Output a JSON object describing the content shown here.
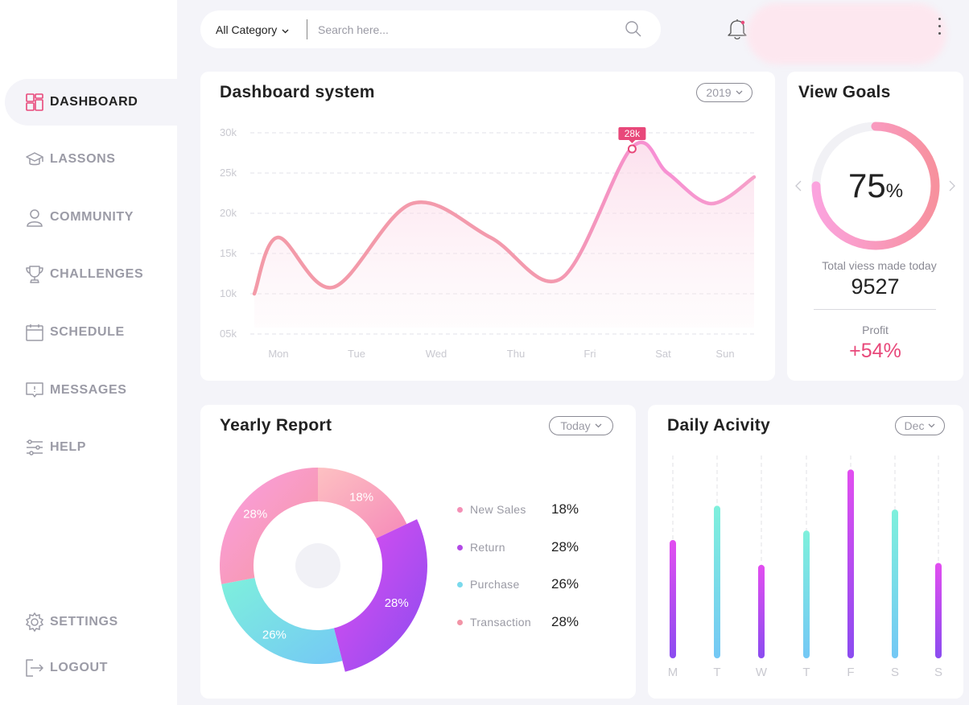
{
  "sidebar": {
    "items": [
      {
        "label": "DASHBOARD",
        "icon": "dashboard-icon",
        "active": true
      },
      {
        "label": "LASSONS",
        "icon": "graduation-cap-icon"
      },
      {
        "label": "COMMUNITY",
        "icon": "user-icon"
      },
      {
        "label": "CHALLENGES",
        "icon": "trophy-icon"
      },
      {
        "label": "SCHEDULE",
        "icon": "calendar-icon"
      },
      {
        "label": "MESSAGES",
        "icon": "message-icon"
      },
      {
        "label": "HELP",
        "icon": "sliders-icon"
      }
    ],
    "bottom": [
      {
        "label": "SETTINGS",
        "icon": "gear-icon"
      },
      {
        "label": "LOGOUT",
        "icon": "logout-icon"
      }
    ]
  },
  "search": {
    "category": "All Category",
    "placeholder": "Search here..."
  },
  "colors": {
    "accent": "#e8487a",
    "pink": "#f6a1b4",
    "purple": "#8b4cf0",
    "magenta": "#e04ef0",
    "teal": "#7ef0dc"
  },
  "dashboard": {
    "title": "Dashboard system",
    "year": "2019",
    "highlight_label": "28k"
  },
  "goals": {
    "title": "View Goals",
    "percent": "75",
    "percent_sign": "%",
    "percent_value": 0.75,
    "views_label": "Total viess made today",
    "views_value": "9527",
    "profit_label": "Profit",
    "profit_value": "+54%"
  },
  "yearly": {
    "title": "Yearly Report",
    "period": "Today",
    "legend": [
      {
        "name": "New Sales",
        "value": "18%",
        "color": "#f490b6"
      },
      {
        "name": "Return",
        "value": "28%",
        "color": "#b24ae6"
      },
      {
        "name": "Purchase",
        "value": "26%",
        "color": "#7ad9ec"
      },
      {
        "name": "Transaction",
        "value": "28%",
        "color": "#f294a6"
      }
    ]
  },
  "daily": {
    "title": "Daily Acivity",
    "month": "Dec"
  },
  "chart_data": [
    {
      "type": "area",
      "title": "Dashboard system",
      "categories": [
        "Mon",
        "Tue",
        "Wed",
        "Thu",
        "Fri",
        "Sat",
        "Sun"
      ],
      "y_ticks": [
        "30k",
        "25k",
        "20k",
        "15k",
        "10k",
        "05k"
      ],
      "ylim": [
        5,
        30
      ],
      "x": [
        0,
        0.3,
        1,
        2,
        3,
        3.9,
        4.8,
        5.25,
        5.8,
        6.35
      ],
      "values": [
        10,
        17,
        10.8,
        21.2,
        17,
        11.9,
        28.2,
        25,
        21.2,
        24.5
      ],
      "highlight": {
        "x": 4.8,
        "value": 28,
        "label": "28k"
      }
    },
    {
      "type": "pie",
      "title": "Yearly Report",
      "labels": [
        "New Sales",
        "Return",
        "Purchase",
        "Transaction"
      ],
      "values": [
        18,
        28,
        26,
        28
      ],
      "slice_labels": [
        "18%",
        "28%",
        "26%",
        "28%"
      ]
    },
    {
      "type": "bar",
      "title": "Daily Acivity",
      "categories": [
        "M",
        "T",
        "W",
        "T",
        "F",
        "S",
        "S"
      ],
      "values": [
        0.62,
        0.8,
        0.49,
        0.67,
        0.99,
        0.78,
        0.5
      ],
      "bar_colors": [
        "magenta",
        "teal",
        "magenta",
        "teal",
        "magenta",
        "teal",
        "magenta"
      ]
    }
  ]
}
